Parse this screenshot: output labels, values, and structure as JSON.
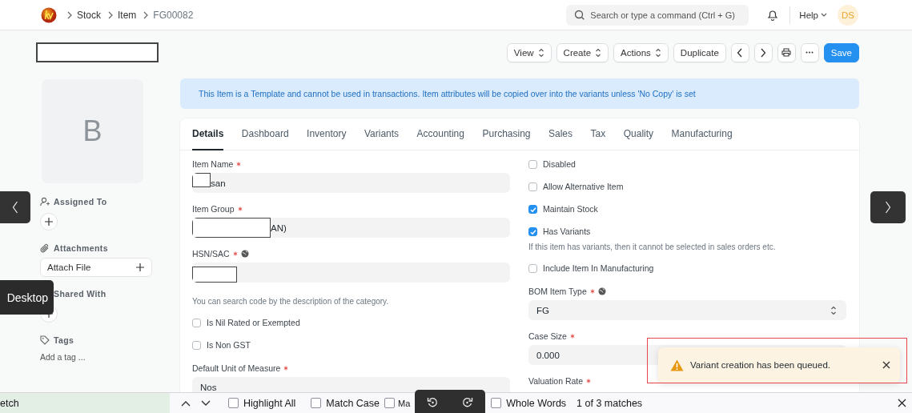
{
  "navbar": {
    "breadcrumbs": [
      "Stock",
      "Item",
      "FG00082"
    ],
    "search": {
      "placeholder": "Search or type a command (Ctrl + G)"
    },
    "help": "Help",
    "avatar": "DS"
  },
  "toolbar": {
    "buttons": [
      {
        "kind": "dropdown",
        "label": "View"
      },
      {
        "kind": "dropdown",
        "label": "Create"
      },
      {
        "kind": "dropdown",
        "label": "Actions"
      },
      {
        "kind": "plain",
        "label": "Duplicate"
      },
      {
        "kind": "prev"
      },
      {
        "kind": "next"
      },
      {
        "kind": "print"
      },
      {
        "kind": "more"
      },
      {
        "kind": "primary",
        "label": "Save"
      }
    ]
  },
  "sidebar": {
    "image_letter": "B",
    "sections": [
      {
        "kind": "assign",
        "title": "Assigned To"
      },
      {
        "kind": "attach",
        "title": "Attachments",
        "button": "Attach File"
      },
      {
        "kind": "share",
        "title": "Shared With"
      },
      {
        "kind": "tags",
        "title": "Tags",
        "link": "Add a tag ..."
      }
    ]
  },
  "alert": "This Item is a Template and cannot be used in transactions. Item attributes will be copied over into the variants unless 'No Copy' is set",
  "tabs": [
    {
      "label": "Details",
      "selected": true
    },
    {
      "label": "Dashboard",
      "selected": false
    },
    {
      "label": "Inventory",
      "selected": false
    },
    {
      "label": "Variants",
      "selected": false
    },
    {
      "label": "Accounting",
      "selected": false
    },
    {
      "label": "Purchasing",
      "selected": false
    },
    {
      "label": "Sales",
      "selected": false
    },
    {
      "label": "Tax",
      "selected": false
    },
    {
      "label": "Quality",
      "selected": false
    },
    {
      "label": "Manufacturing",
      "selected": false
    }
  ],
  "form": {
    "columns": [
      [
        {
          "kind": "data",
          "label": "Item Name",
          "required": true,
          "value": "san",
          "redacted": true
        },
        {
          "kind": "data",
          "label": "Item Group",
          "required": true,
          "value": "AN)",
          "redacted": true
        },
        {
          "kind": "data",
          "label": "HSN/SAC",
          "required": true,
          "info": true,
          "redacted": true,
          "description": "You can search code by the description of the category."
        },
        {
          "kind": "check",
          "label": "Is Nil Rated or Exempted",
          "checked": false
        },
        {
          "kind": "check",
          "label": "Is Non GST",
          "checked": false
        },
        {
          "kind": "data",
          "label": "Default Unit of Measure",
          "required": true,
          "value": "Nos"
        }
      ],
      [
        {
          "kind": "check",
          "label": "Disabled",
          "checked": false
        },
        {
          "kind": "check",
          "label": "Allow Alternative Item",
          "checked": false
        },
        {
          "kind": "check",
          "label": "Maintain Stock",
          "checked": true
        },
        {
          "kind": "check",
          "label": "Has Variants",
          "checked": true,
          "description": "If this item has variants, then it cannot be selected in sales orders etc."
        },
        {
          "kind": "check",
          "label": "Include Item In Manufacturing",
          "checked": false
        },
        {
          "kind": "select",
          "label": "BOM Item Type",
          "required": true,
          "info": true,
          "value": "FG"
        },
        {
          "kind": "data",
          "label": "Case Size",
          "required": true,
          "value": "0.000"
        },
        {
          "kind": "label",
          "label": "Valuation Rate",
          "required": true
        }
      ]
    ]
  },
  "toast": {
    "message": "Variant creation has been queued.",
    "highlighted": true
  },
  "overlays": {
    "tooltip": "Desktop"
  },
  "find_bar": {
    "value": "etch",
    "options": [
      {
        "label": "Highlight All",
        "checked": false
      },
      {
        "label": "Match Case",
        "checked": false
      },
      {
        "label": "Ma",
        "checked": false
      },
      {
        "label": "Whole Words",
        "checked": false
      }
    ],
    "status": "1 of 3 matches"
  }
}
